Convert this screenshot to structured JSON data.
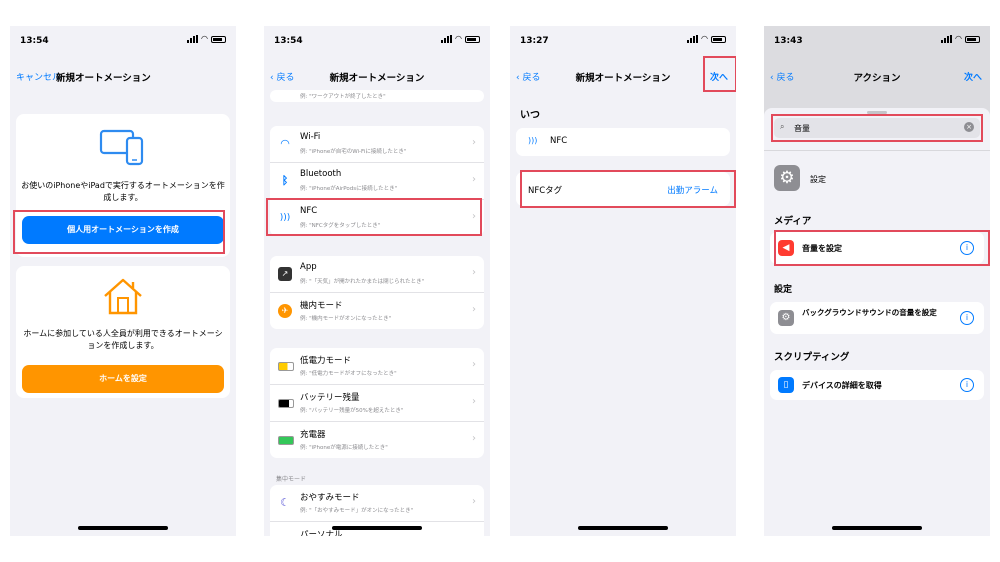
{
  "accent_color": "#007aff",
  "highlight_color": "#e24a5b",
  "panel1": {
    "time": "13:54",
    "cancel": "キャンセル",
    "title": "新規オートメーション",
    "personal_desc": "お使いのiPhoneやiPadで実行するオートメーションを作成します。",
    "personal_button": "個人用オートメーションを作成",
    "home_desc": "ホームに参加している人全員が利用できるオートメーションを作成します。",
    "home_button": "ホームを設定",
    "device_icon": "devices-icon",
    "home_icon": "house-icon"
  },
  "panel2": {
    "time": "13:54",
    "back": "戻る",
    "title": "新規オートメーション",
    "top_sub": "例: \"ワークアウトが終了したとき\"",
    "group1": [
      {
        "title": "Wi-Fi",
        "subtitle": "例: \"iPhoneが自宅のWi-Fiに接続したとき\"",
        "icon": "wifi-icon"
      },
      {
        "title": "Bluetooth",
        "subtitle": "例: \"iPhoneがAirPodsに接続したとき\"",
        "icon": "bluetooth-icon"
      },
      {
        "title": "NFC",
        "subtitle": "例: \"NFCタグをタップしたとき\"",
        "icon": "nfc-icon"
      }
    ],
    "group2": [
      {
        "title": "App",
        "subtitle": "例: \"「天気」が開かれたかまたは閉じられたとき\"",
        "icon": "app-icon"
      },
      {
        "title": "機内モード",
        "subtitle": "例: \"機内モードがオンになったとき\"",
        "icon": "airplane-icon"
      }
    ],
    "group3": [
      {
        "title": "低電力モード",
        "subtitle": "例: \"低電力モードがオフになったとき\"",
        "icon": "low-power-icon"
      },
      {
        "title": "バッテリー残量",
        "subtitle": "例: \"バッテリー残量が50%を超えたとき\"",
        "icon": "battery-icon"
      },
      {
        "title": "充電器",
        "subtitle": "例: \"iPhoneが電源に接続したとき\"",
        "icon": "charger-icon"
      }
    ],
    "focus_label": "集中モード",
    "group4": [
      {
        "title": "おやすみモード",
        "subtitle": "例: \"「おやすみモード」がオンになったとき\"",
        "icon": "moon-icon"
      },
      {
        "title": "パーソナル",
        "subtitle": "",
        "icon": "person-icon"
      }
    ]
  },
  "panel3": {
    "time": "13:27",
    "back": "戻る",
    "title": "新規オートメーション",
    "next": "次へ",
    "when_label": "いつ",
    "nfc_label": "NFC",
    "tag_label": "NFCタグ",
    "tag_value": "出勤アラーム"
  },
  "panel4": {
    "time": "13:43",
    "back": "戻る",
    "title": "アクション",
    "next": "次へ",
    "search_value": "音量",
    "settings_app": "設定",
    "media_label": "メディア",
    "set_volume": "音量を設定",
    "settings_label": "設定",
    "bg_sound_volume": "バックグラウンドサウンドの音量を設定",
    "scripting_label": "スクリプティング",
    "get_device_details": "デバイスの詳細を取得"
  }
}
